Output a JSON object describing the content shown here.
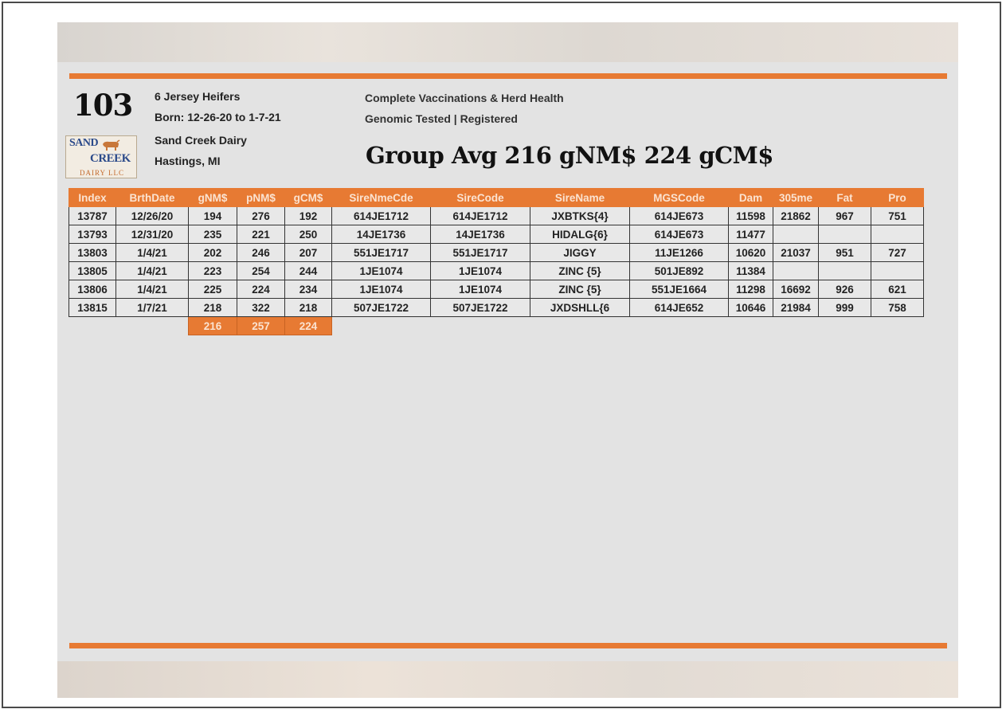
{
  "lot": {
    "number": "103",
    "title": "6 Jersey Heifers",
    "born": "Born: 12-26-20 to 1-7-21",
    "farm": "Sand Creek Dairy",
    "location": "Hastings, MI",
    "line1": "Complete Vaccinations & Herd Health",
    "line2": "Genomic Tested | Registered",
    "group_avg": "Group Avg 216 gNM$  224 gCM$"
  },
  "logo": {
    "word1": "SAND",
    "word2": "CREEK",
    "word3": "DAIRY LLC"
  },
  "colors": {
    "accent": "#e77a33",
    "background": "#e3e3e3"
  },
  "table": {
    "headers": [
      "Index",
      "BrthDate",
      "gNM$",
      "pNM$",
      "gCM$",
      "SireNmeCde",
      "SireCode",
      "SireName",
      "MGSCode",
      "Dam",
      "305me",
      "Fat",
      "Pro"
    ],
    "rows": [
      [
        "13787",
        "12/26/20",
        "194",
        "276",
        "192",
        "614JE1712",
        "614JE1712",
        "JXBTKS{4}",
        "614JE673",
        "11598",
        "21862",
        "967",
        "751"
      ],
      [
        "13793",
        "12/31/20",
        "235",
        "221",
        "250",
        "14JE1736",
        "14JE1736",
        "HIDALG{6}",
        "614JE673",
        "11477",
        "",
        "",
        ""
      ],
      [
        "13803",
        "1/4/21",
        "202",
        "246",
        "207",
        "551JE1717",
        "551JE1717",
        "JIGGY",
        "11JE1266",
        "10620",
        "21037",
        "951",
        "727"
      ],
      [
        "13805",
        "1/4/21",
        "223",
        "254",
        "244",
        "1JE1074",
        "1JE1074",
        "ZINC {5}",
        "501JE892",
        "11384",
        "",
        "",
        ""
      ],
      [
        "13806",
        "1/4/21",
        "225",
        "224",
        "234",
        "1JE1074",
        "1JE1074",
        "ZINC {5}",
        "551JE1664",
        "11298",
        "16692",
        "926",
        "621"
      ],
      [
        "13815",
        "1/7/21",
        "218",
        "322",
        "218",
        "507JE1722",
        "507JE1722",
        "JXDSHLL{6",
        "614JE652",
        "10646",
        "21984",
        "999",
        "758"
      ]
    ],
    "averages": [
      "216",
      "257",
      "224"
    ]
  }
}
